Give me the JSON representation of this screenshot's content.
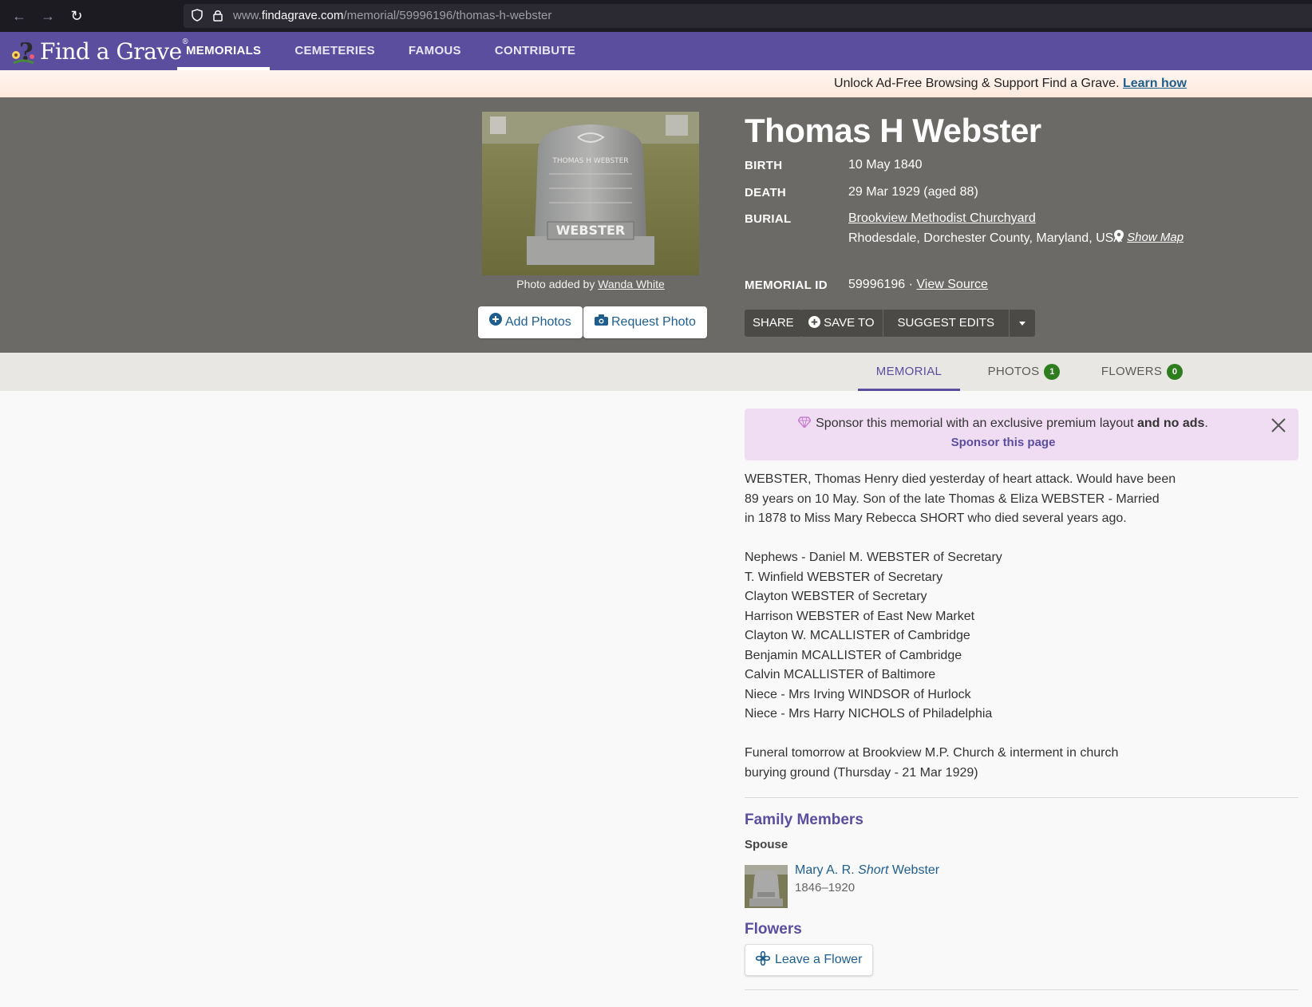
{
  "browser": {
    "url_prefix": "www.",
    "url_domain": "findagrave.com",
    "url_path": "/memorial/59996196/thomas-h-webster"
  },
  "header": {
    "logo_text": "Find a Grave",
    "logo_reg": "®",
    "nav": [
      "MEMORIALS",
      "CEMETERIES",
      "FAMOUS",
      "CONTRIBUTE"
    ]
  },
  "promo": {
    "text": "Unlock Ad-Free Browsing & Support Find a Grave.",
    "link": "Learn how"
  },
  "photo": {
    "caption_prefix": "Photo added by",
    "added_by": "Wanda White",
    "stone_top": "THOMAS H WEBSTER",
    "stone_name": "WEBSTER"
  },
  "buttons": {
    "add_photos": "Add Photos",
    "request_photo": "Request Photo",
    "share": "SHARE",
    "save_to": "SAVE TO",
    "suggest_edits": "SUGGEST EDITS"
  },
  "memorial": {
    "name": "Thomas H Webster",
    "birth_label": "BIRTH",
    "birth": "10 May 1840",
    "death_label": "DEATH",
    "death": "29 Mar 1929 (aged 88)",
    "burial_label": "BURIAL",
    "cemetery": "Brookview Methodist Churchyard",
    "location": "Rhodesdale, Dorchester County, Maryland, USA",
    "show_map": "Show Map",
    "id_label": "MEMORIAL ID",
    "id": "59996196 ·",
    "view_source": "View Source"
  },
  "tabs": {
    "memorial": "MEMORIAL",
    "photos": "PHOTOS",
    "photos_count": "1",
    "flowers": "FLOWERS",
    "flowers_count": "0"
  },
  "sponsor": {
    "text": "Sponsor this memorial with an exclusive premium layout",
    "bold": "and no ads",
    "period": ".",
    "link": "Sponsor this page"
  },
  "bio": {
    "p1": [
      "WEBSTER, Thomas Henry died yesterday of heart attack. Would have been",
      "89 years on 10 May. Son of the late Thomas & Eliza WEBSTER - Married",
      "in 1878 to Miss Mary Rebecca SHORT who died several years ago."
    ],
    "p2": [
      "Nephews - Daniel M. WEBSTER of Secretary",
      "T. Winfield WEBSTER of Secretary",
      "Clayton WEBSTER of Secretary",
      "Harrison WEBSTER of East New Market",
      "Clayton W. MCALLISTER of Cambridge",
      "Benjamin MCALLISTER of Cambridge",
      "Calvin MCALLISTER of Baltimore",
      "Niece - Mrs Irving WINDSOR of Hurlock",
      "Niece - Mrs Harry NICHOLS of Philadelphia"
    ],
    "p3": [
      "Funeral tomorrow at Brookview M.P. Church & interment in church",
      "burying ground (Thursday - 21 Mar 1929)"
    ]
  },
  "family": {
    "title": "Family Members",
    "relation": "Spouse",
    "first": "Mary A. R.",
    "maiden": "Short",
    "last": "Webster",
    "dates": "1846–1920"
  },
  "flowers": {
    "title": "Flowers",
    "button": "Leave a Flower"
  }
}
